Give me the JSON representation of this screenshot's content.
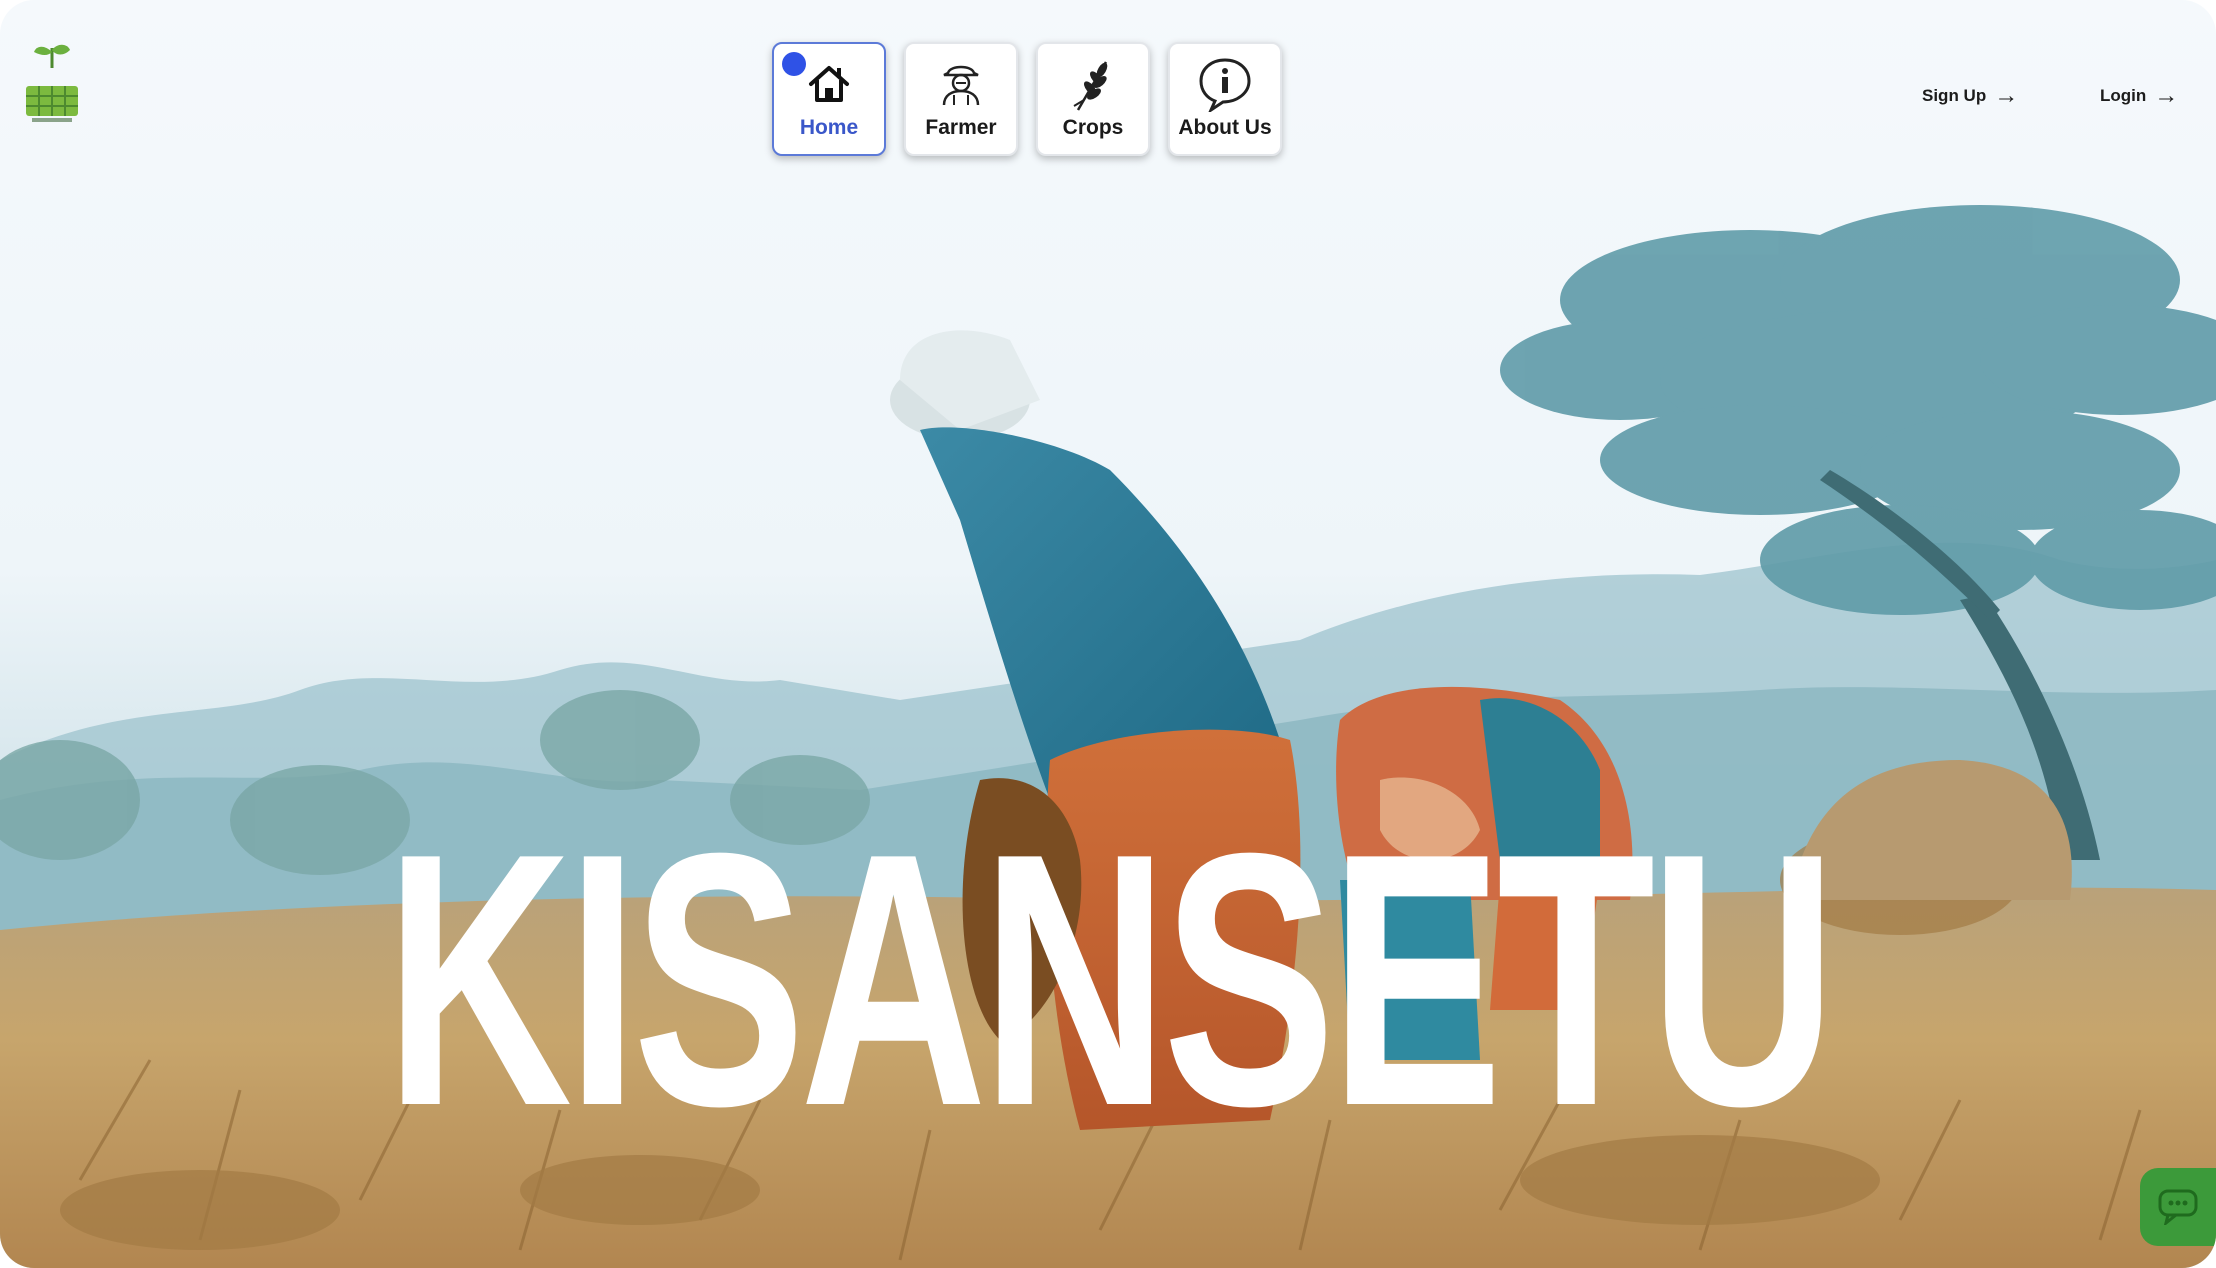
{
  "brand": {
    "name": "KISANSETU",
    "logo_icon": "sprout-logo-icon"
  },
  "nav": {
    "items": [
      {
        "label": "Home",
        "icon": "home-icon",
        "active": true
      },
      {
        "label": "Farmer",
        "icon": "farmer-icon",
        "active": false
      },
      {
        "label": "Crops",
        "icon": "wheat-icon",
        "active": false
      },
      {
        "label": "About Us",
        "icon": "info-icon",
        "active": false
      }
    ]
  },
  "auth": {
    "signup_label": "Sign Up",
    "login_label": "Login",
    "arrow_icon": "arrow-right-icon"
  },
  "hero": {
    "title": "KISANSETU",
    "image": "farmers-harvesting-field-photo"
  },
  "chat": {
    "icon": "chat-icon"
  },
  "colors": {
    "active_nav": "#3a57c9",
    "active_dot": "#2f52e6",
    "chat_fab": "#3c9a3a"
  }
}
